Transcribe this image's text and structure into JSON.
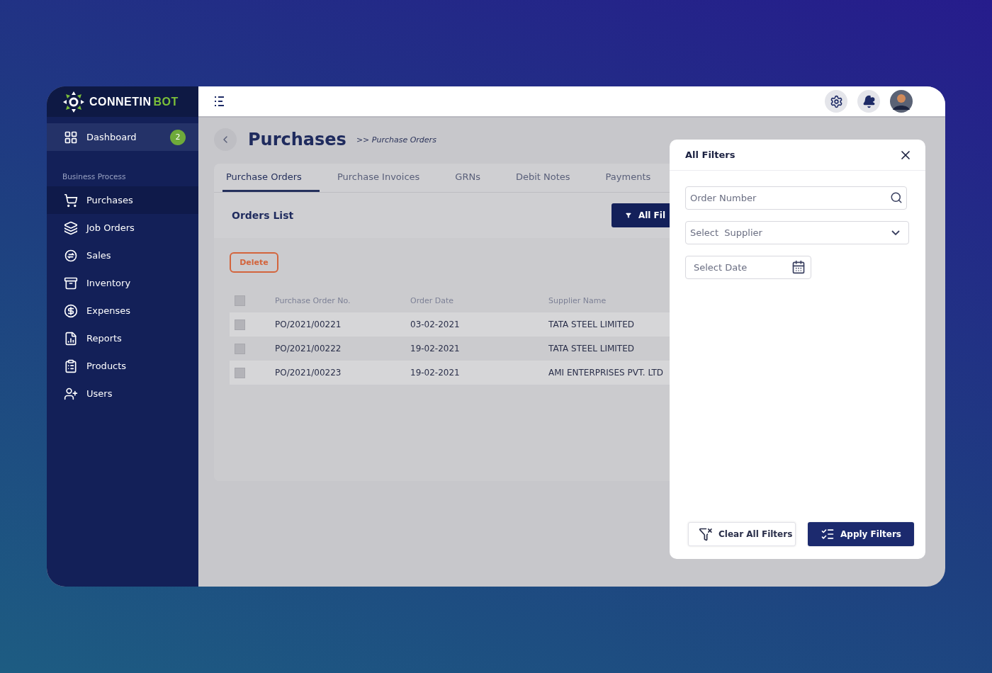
{
  "logo": {
    "name": "CONNETIN",
    "accent": "BOT"
  },
  "sidebar": {
    "dashboard": {
      "label": "Dashboard",
      "badge": "2"
    },
    "section": "Business Process",
    "items": [
      {
        "label": "Purchases",
        "selected": true
      },
      {
        "label": "Job Orders",
        "selected": false
      },
      {
        "label": "Sales",
        "selected": false
      },
      {
        "label": "Inventory",
        "selected": false
      },
      {
        "label": "Expenses",
        "selected": false
      },
      {
        "label": "Reports",
        "selected": false
      },
      {
        "label": "Products",
        "selected": false
      },
      {
        "label": "Users",
        "selected": false
      }
    ]
  },
  "topbar": {
    "notifications_unread": true
  },
  "page": {
    "title": "Purchases",
    "breadcrumb": ">> Purchase Orders"
  },
  "tabs": [
    {
      "label": "Purchase Orders",
      "selected": true
    },
    {
      "label": "Purchase Invoices",
      "selected": false
    },
    {
      "label": "GRNs",
      "selected": false
    },
    {
      "label": "Debit Notes",
      "selected": false
    },
    {
      "label": "Payments",
      "selected": false
    }
  ],
  "orders": {
    "title": "Orders List",
    "filter_button": "All Fil",
    "delete_button": "Delete",
    "table": {
      "select_all_checked": false,
      "columns": [
        "Purchase Order No.",
        "Order Date",
        "Supplier Name"
      ],
      "rows": [
        {
          "checked": false,
          "cells": [
            "PO/2021/00221",
            "03-02-2021",
            "TATA STEEL LIMITED"
          ]
        },
        {
          "checked": false,
          "cells": [
            "PO/2021/00222",
            "19-02-2021",
            "TATA STEEL LIMITED"
          ]
        },
        {
          "checked": false,
          "cells": [
            "PO/2021/00223",
            "19-02-2021",
            "AMI ENTERPRISES PVT. LTD"
          ]
        }
      ]
    }
  },
  "filters": {
    "title": "All Filters",
    "order_number": {
      "placeholder": "Order Number"
    },
    "supplier": {
      "placeholder": "Select  Supplier"
    },
    "date": {
      "placeholder": "Select Date"
    },
    "buttons": [
      {
        "label": "Clear All Filters",
        "kind": "secondary"
      },
      {
        "label": "Apply Filters",
        "kind": "primary"
      }
    ]
  }
}
